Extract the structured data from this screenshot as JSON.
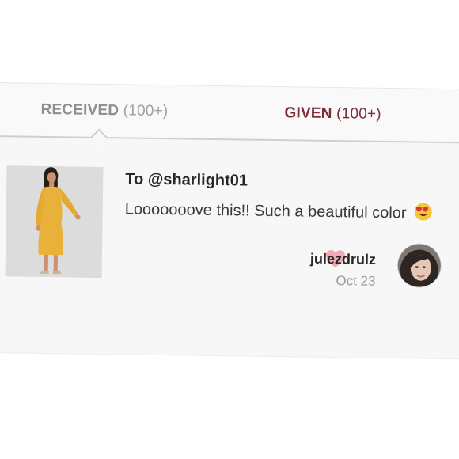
{
  "tabs": {
    "received": {
      "label": "RECEIVED",
      "count": "(100+)"
    },
    "given": {
      "label": "GIVEN",
      "count": "(100+)"
    },
    "active": "received"
  },
  "comment": {
    "to": "To @sharlight01",
    "text": "Looooooove this!! Such a beautiful color",
    "emoji": "heart-eyes-icon",
    "author": "julezdrulz",
    "date": "Oct 23",
    "liked": true,
    "thumbnail": "yellow-dress-product-image"
  },
  "colors": {
    "given_tab": "#7c2b37",
    "heart": "#f4a7b4",
    "dress": "#e8b23a"
  }
}
